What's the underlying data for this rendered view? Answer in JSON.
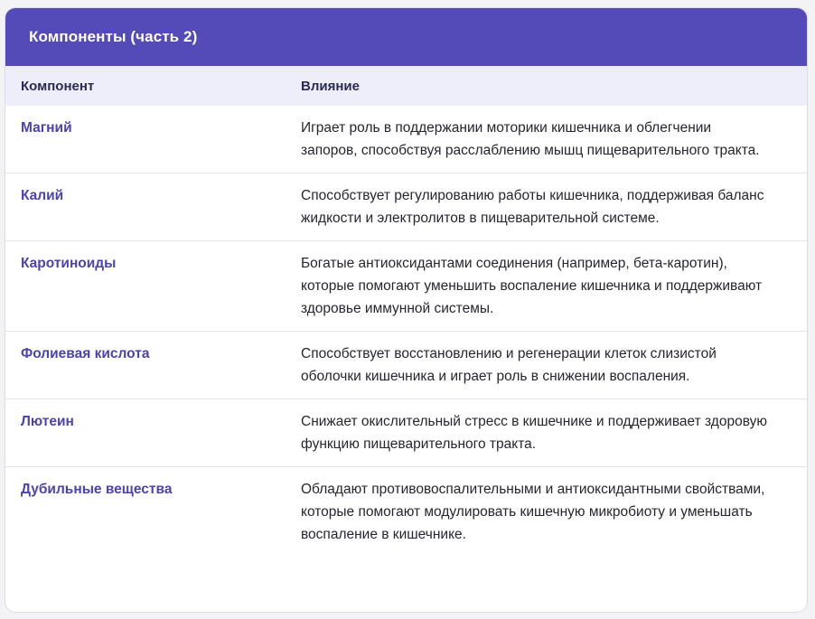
{
  "card": {
    "title": "Компоненты (часть 2)"
  },
  "table": {
    "headers": [
      "Компонент",
      "Влияние"
    ],
    "rows": [
      {
        "component": "Магний",
        "effect": "Играет роль в поддержании моторики кишечника и облегчении запоров, способствуя расслаблению мышц пищеварительного тракта."
      },
      {
        "component": "Калий",
        "effect": "Способствует регулированию работы кишечника, поддерживая баланс жидкости и электролитов в пищеварительной системе."
      },
      {
        "component": "Каротиноиды",
        "effect": "Богатые антиоксидантами соединения (например, бета-каротин), которые помогают уменьшить воспаление кишечника и поддерживают здоровье иммунной системы."
      },
      {
        "component": "Фолиевая кислота",
        "effect": "Способствует восстановлению и регенерации клеток слизистой оболочки кишечника и играет роль в снижении воспаления."
      },
      {
        "component": "Лютеин",
        "effect": "Снижает окислительный стресс в кишечнике и поддерживает здоровую функцию пищеварительного тракта."
      },
      {
        "component": "Дубильные вещества",
        "effect": "Обладают противовоспалительными и антиоксидантными свойствами, которые помогают модулировать кишечную микробиоту и уменьшать воспаление в кишечнике."
      }
    ]
  },
  "colors": {
    "header_bg": "#554bb8",
    "thead_bg": "#eeeefb",
    "component_text": "#4b43b0"
  }
}
